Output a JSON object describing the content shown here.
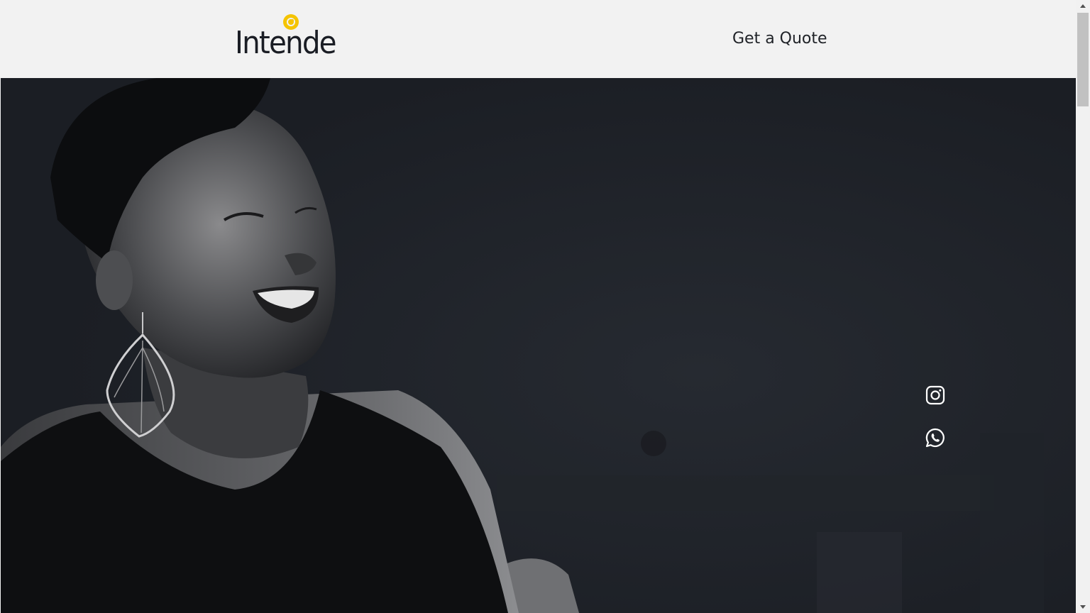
{
  "brand": {
    "name": "Intende",
    "accent_color": "#f5c400",
    "text_color": "#1a1d24"
  },
  "header": {
    "cta_label": "Get a Quote"
  },
  "hero": {
    "image_alt": "Smiling woman with large leaf earring, black and white photo",
    "background_color": "#1c1f25"
  },
  "social": {
    "items": [
      {
        "name": "instagram",
        "icon": "instagram-icon"
      },
      {
        "name": "whatsapp",
        "icon": "whatsapp-icon"
      }
    ]
  }
}
